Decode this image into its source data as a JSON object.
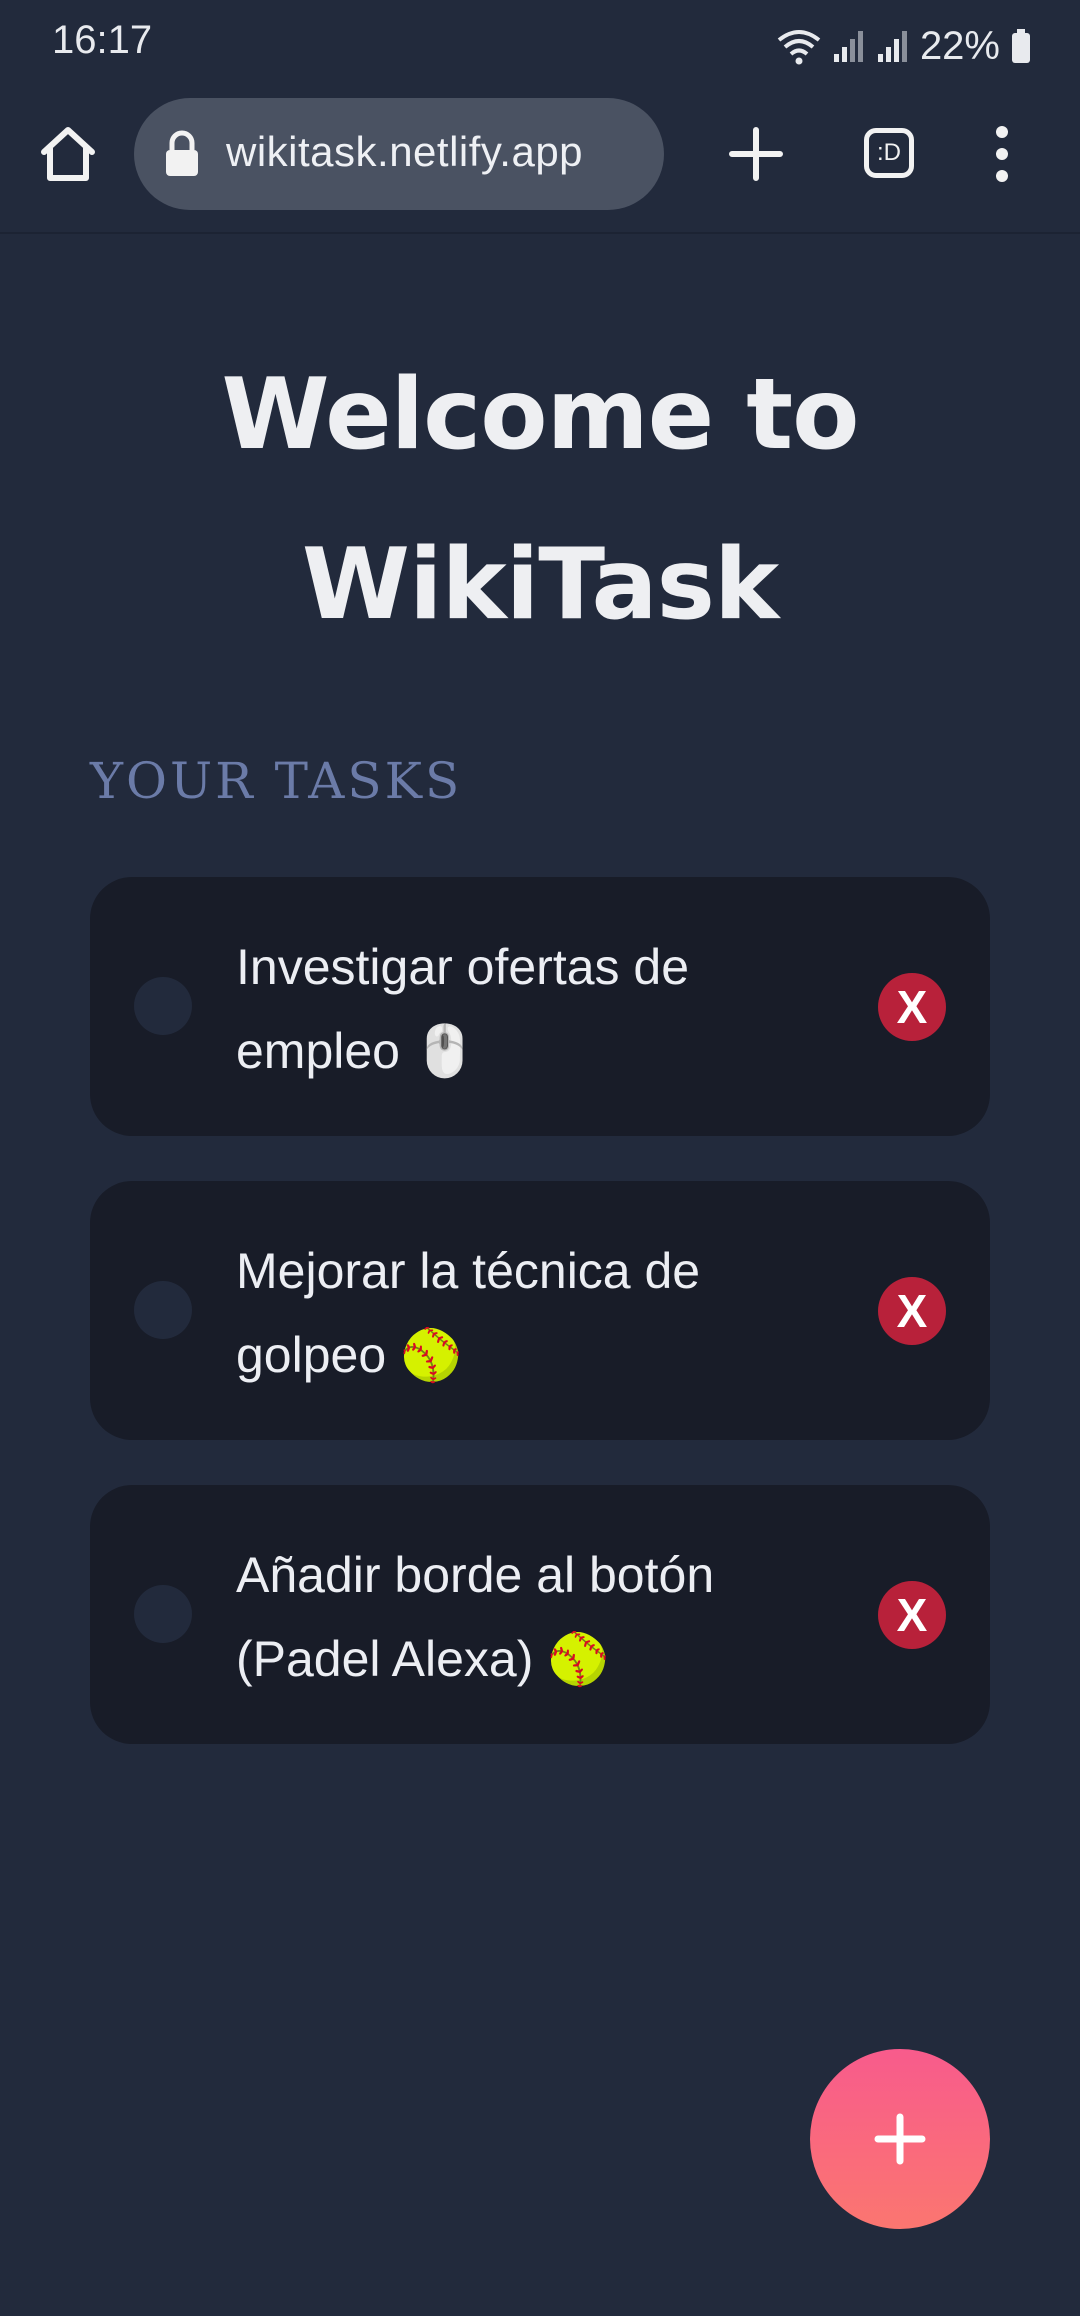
{
  "status_bar": {
    "time": "16:17",
    "battery_percent": "22%",
    "icons": [
      "wifi-icon",
      "signal-icon",
      "signal-icon",
      "battery-icon"
    ]
  },
  "browser": {
    "url": "wikitask.netlify.app",
    "tabs_label": ":D",
    "icons": [
      "home-icon",
      "lock-icon",
      "plus-icon",
      "tabs-icon",
      "more-vert-icon"
    ]
  },
  "page": {
    "title_line1": "Welcome to",
    "title_line2": "WikiTask",
    "section_label": "YOUR TASKS"
  },
  "tasks": [
    {
      "line1": "Investigar ofertas de",
      "line2": "empleo 🖱️",
      "delete_label": "X",
      "completed": false
    },
    {
      "line1": "Mejorar la técnica de",
      "line2": "golpeo 🥎",
      "delete_label": "X",
      "completed": false
    },
    {
      "line1": "Añadir borde al botón",
      "line2": "(Padel Alexa) 🥎",
      "delete_label": "X",
      "completed": false
    }
  ],
  "fab": {
    "icon": "plus-icon"
  },
  "colors": {
    "background": "#222a3c",
    "card": "#181c28",
    "section_label": "#6b7ba8",
    "delete": "#b8213a",
    "fab_top": "#f85b8c",
    "fab_bottom": "#fb7670"
  }
}
